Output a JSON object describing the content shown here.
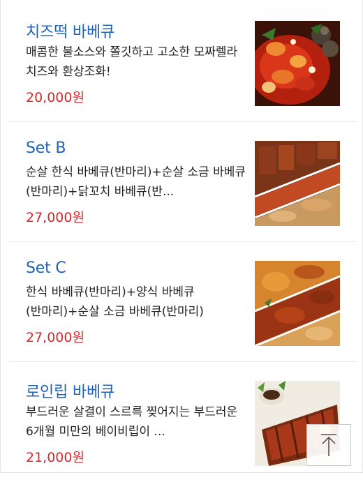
{
  "menu": {
    "items": [
      {
        "name": "치즈떡 바베큐",
        "description": "매콤한 불소스와 쫄깃하고 고소한 모짜렐라 치즈와 환상조화!",
        "price": "20,000원",
        "image_alt": "치즈떡 바베큐 사진"
      },
      {
        "name": "Set B",
        "description": "순살 한식 바베큐(반마리)+순살 소금 바베큐(반마리)+닭꼬치 바베큐(반...",
        "price": "27,000원",
        "image_alt": "Set B 사진"
      },
      {
        "name": "Set C",
        "description": "한식 바베큐(반마리)+양식 바베큐(반마리)+순살 소금 바베큐(반마리)",
        "price": "27,000원",
        "image_alt": "Set C 사진"
      },
      {
        "name": "로인립 바베큐",
        "description": "부드러운 살결이 스르륵 찢어지는 부드러운 6개월 미만의 베이비립이 ...",
        "price": "21,000원",
        "image_alt": "로인립 바베큐 사진"
      }
    ]
  },
  "scroll_top_icon": "arrow-up-to-top",
  "colors": {
    "name": "#1f63b6",
    "price": "#d7292c",
    "text": "#222222",
    "divider": "#e9e9e9"
  }
}
